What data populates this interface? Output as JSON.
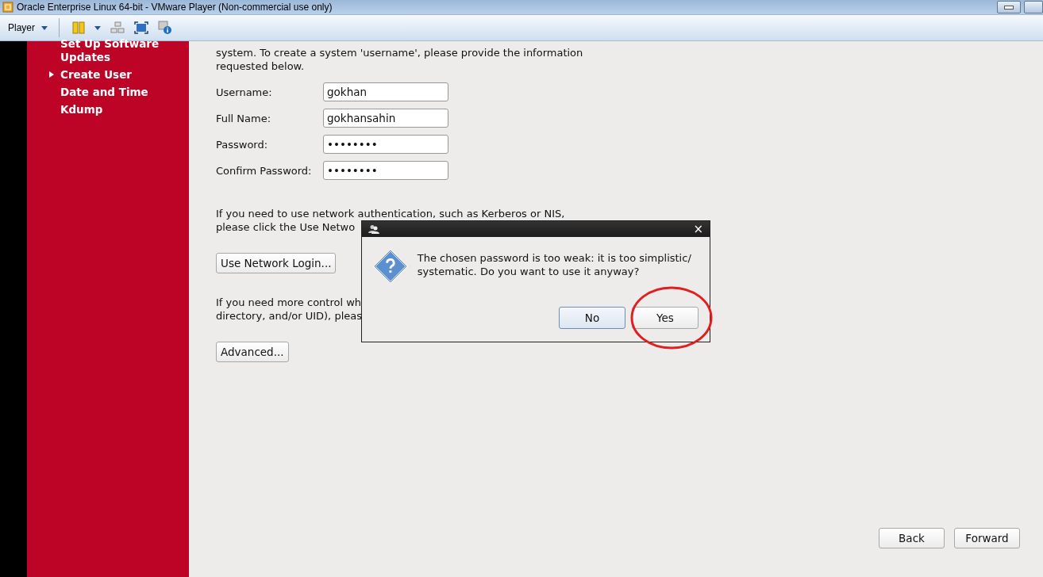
{
  "window": {
    "title": "Oracle Enterprise Linux 64-bit - VMware Player (Non-commercial use only)"
  },
  "toolbar": {
    "menu": "Player"
  },
  "sidebar": {
    "items": [
      {
        "label": "Set Up Software Updates",
        "selected": false
      },
      {
        "label": "Create User",
        "selected": true
      },
      {
        "label": "Date and Time",
        "selected": false
      },
      {
        "label": "Kdump",
        "selected": false
      }
    ]
  },
  "intro": "system.  To create a system 'username', please provide the information requested below.",
  "fields": [
    {
      "label": "Username:",
      "value": "gokhan"
    },
    {
      "label": "Full Name:",
      "value": "gokhansahin"
    },
    {
      "label": "Password:",
      "value": "••••••••"
    },
    {
      "label": "Confirm Password:",
      "value": "••••••••"
    }
  ],
  "network_text": [
    "If you need to use network authentication, such as Kerberos or NIS,",
    "please click the Use Netwo"
  ],
  "network_button": "Use Network Login...",
  "advanced_text": [
    "If you need more control wh",
    "directory, and/or UID), pleas"
  ],
  "advanced_button": "Advanced...",
  "nav_buttons": [
    "Back",
    "Forward"
  ],
  "dialog": {
    "close": "×",
    "message": "The chosen password is too weak: it is too simplistic/ systematic. Do you want to use it anyway?",
    "buttons": [
      {
        "label": "No",
        "selected": true
      },
      {
        "label": "Yes",
        "selected": false
      }
    ]
  }
}
